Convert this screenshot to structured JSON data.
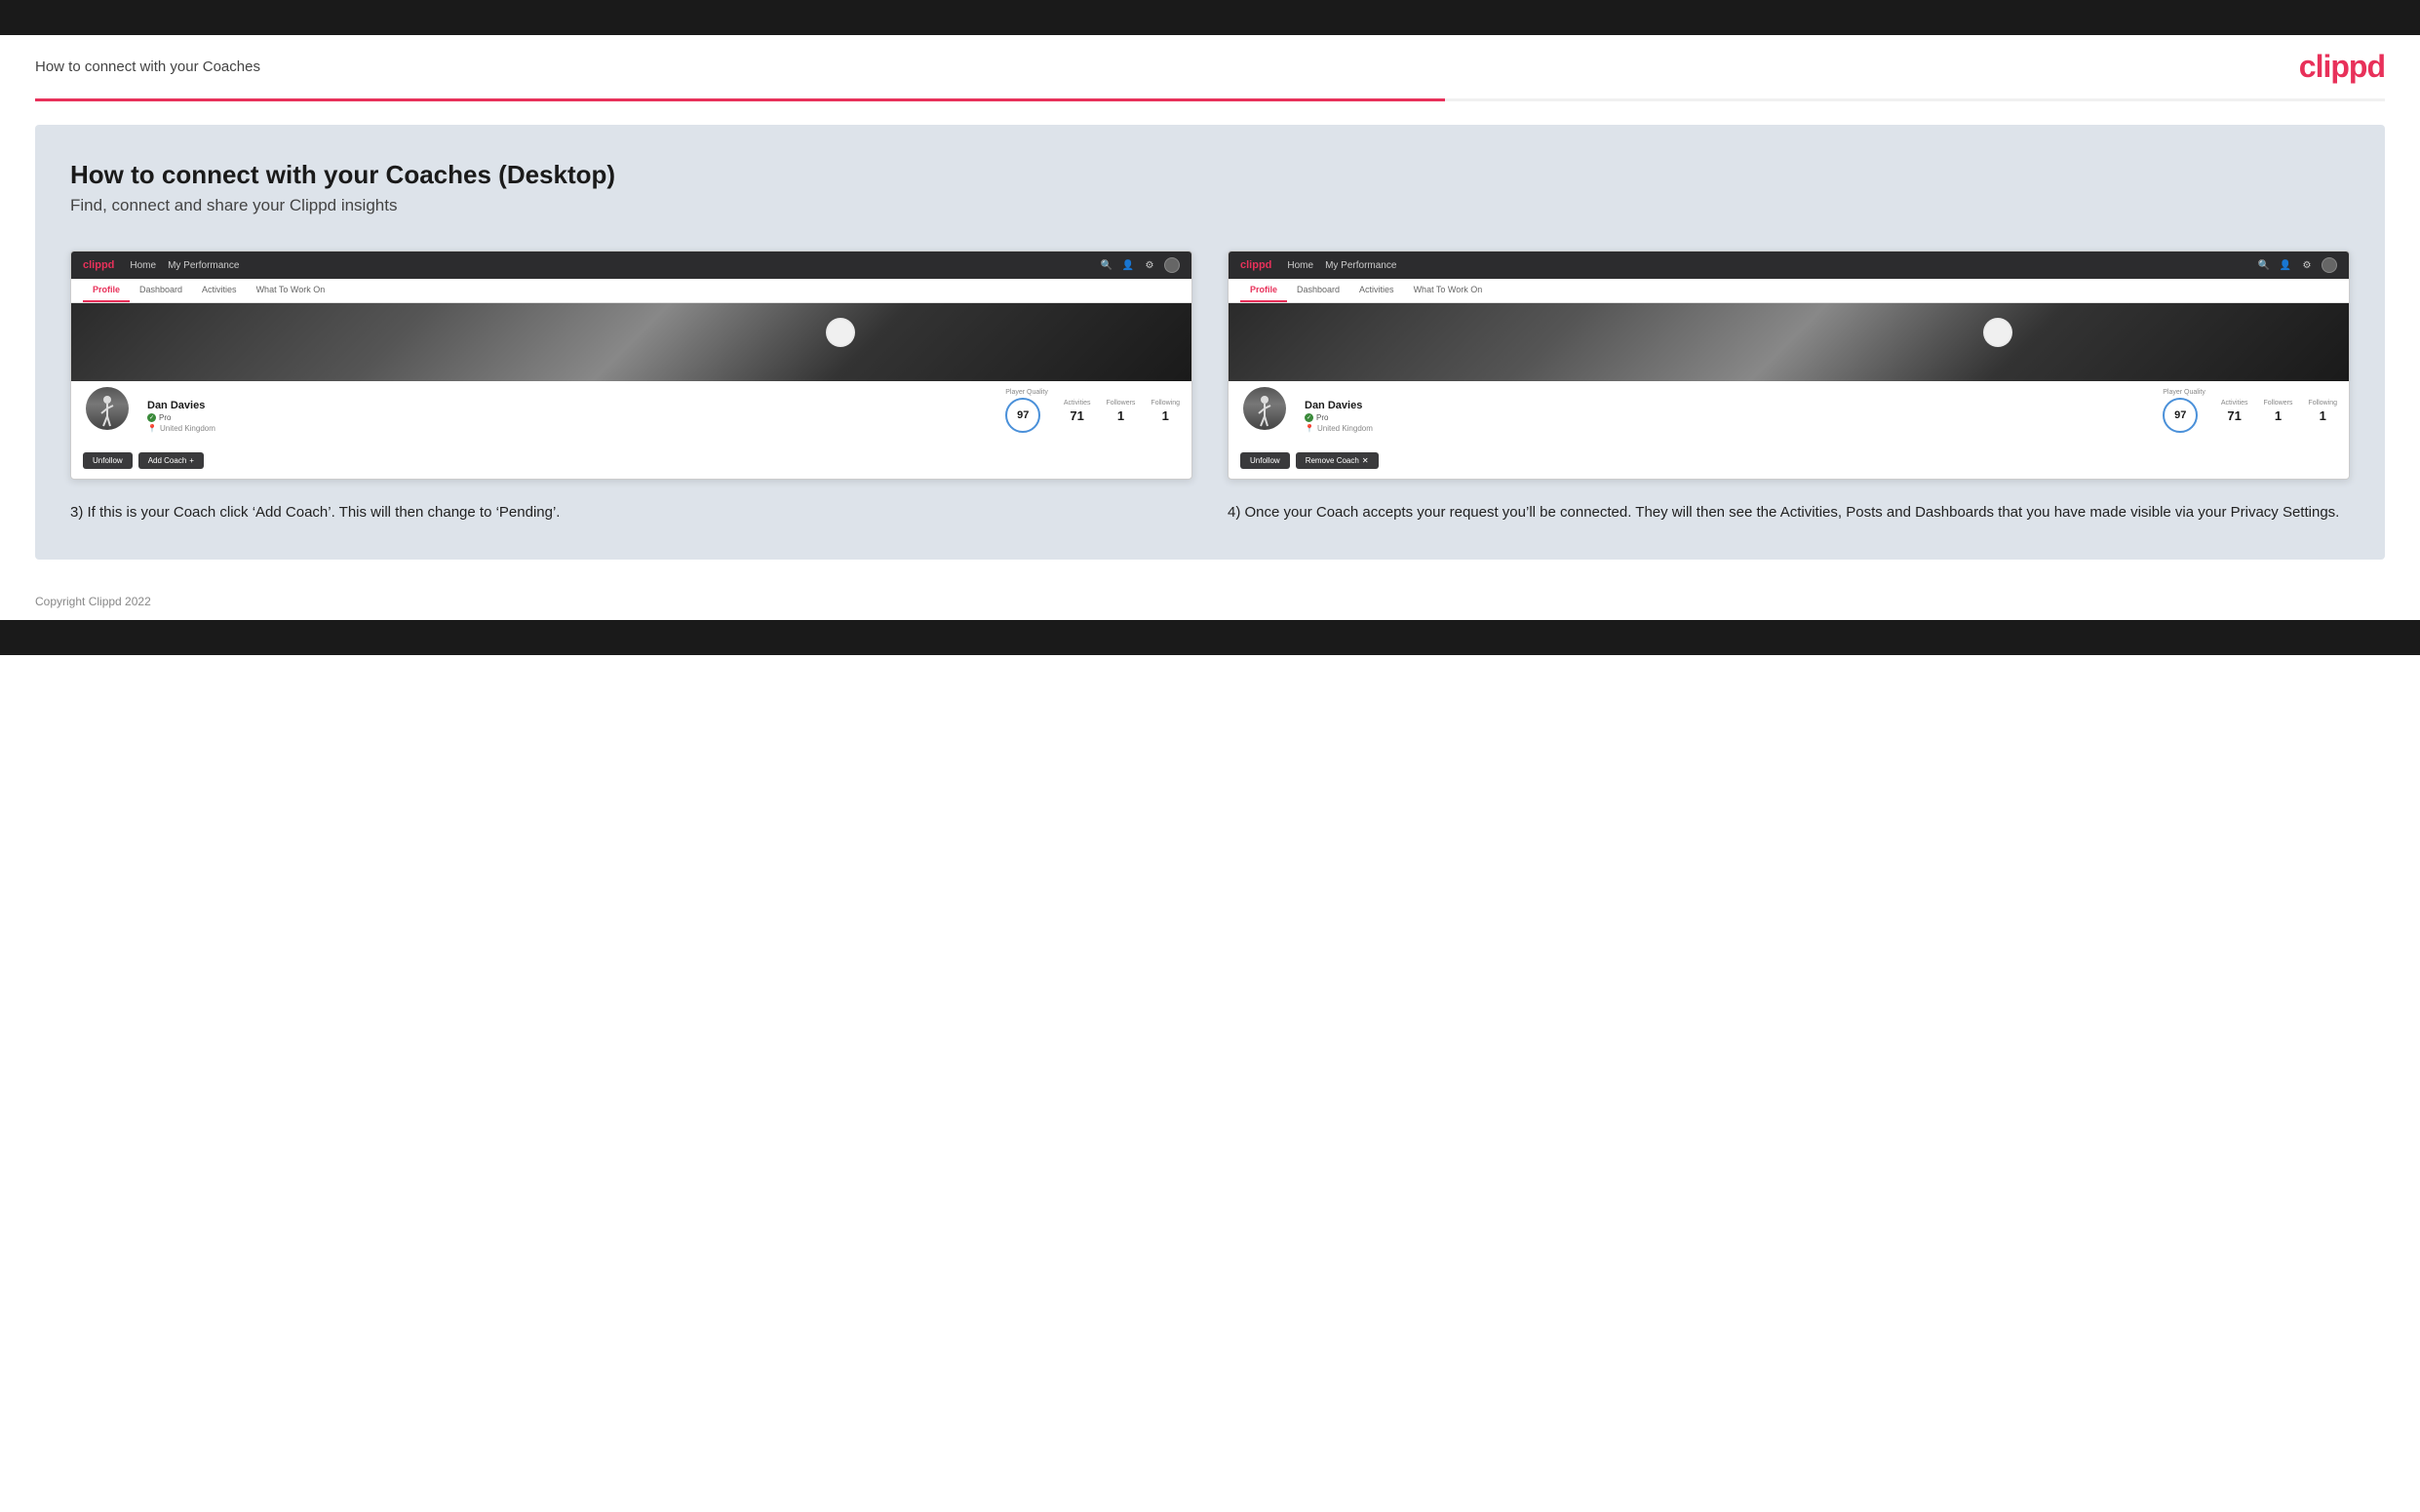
{
  "header": {
    "title": "How to connect with your Coaches",
    "logo": "clippd"
  },
  "page": {
    "heading": "How to connect with your Coaches (Desktop)",
    "subheading": "Find, connect and share your Clippd insights"
  },
  "mockup_left": {
    "nav": {
      "logo": "clippd",
      "links": [
        "Home",
        "My Performance"
      ],
      "tab_items": [
        "Profile",
        "Dashboard",
        "Activities",
        "What To Work On"
      ],
      "active_tab": "Profile"
    },
    "profile": {
      "name": "Dan Davies",
      "badge": "Pro",
      "location": "United Kingdom",
      "player_quality": "97",
      "activities": "71",
      "followers": "1",
      "following": "1",
      "player_quality_label": "Player Quality",
      "activities_label": "Activities",
      "followers_label": "Followers",
      "following_label": "Following"
    },
    "buttons": {
      "unfollow": "Unfollow",
      "add_coach": "Add Coach"
    }
  },
  "mockup_right": {
    "nav": {
      "logo": "clippd",
      "links": [
        "Home",
        "My Performance"
      ],
      "tab_items": [
        "Profile",
        "Dashboard",
        "Activities",
        "What To Work On"
      ],
      "active_tab": "Profile"
    },
    "profile": {
      "name": "Dan Davies",
      "badge": "Pro",
      "location": "United Kingdom",
      "player_quality": "97",
      "activities": "71",
      "followers": "1",
      "following": "1",
      "player_quality_label": "Player Quality",
      "activities_label": "Activities",
      "followers_label": "Followers",
      "following_label": "Following"
    },
    "buttons": {
      "unfollow": "Unfollow",
      "remove_coach": "Remove Coach"
    }
  },
  "descriptions": {
    "left": "3) If this is your Coach click ‘Add Coach’. This will then change to ‘Pending’.",
    "right": "4) Once your Coach accepts your request you’ll be connected. They will then see the Activities, Posts and Dashboards that you have made visible via your Privacy Settings."
  },
  "footer": {
    "copyright": "Copyright Clippd 2022"
  }
}
